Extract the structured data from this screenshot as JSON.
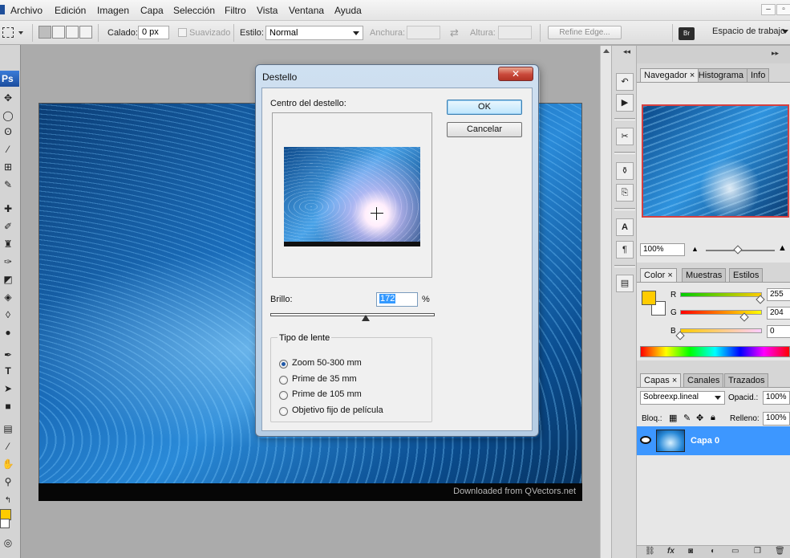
{
  "menubar": {
    "items": [
      "Archivo",
      "Edición",
      "Imagen",
      "Capa",
      "Selección",
      "Filtro",
      "Vista",
      "Ventana",
      "Ayuda"
    ]
  },
  "options": {
    "feather_label": "Calado:",
    "feather_value": "0 px",
    "antialias_label": "Suavizado",
    "style_label": "Estilo:",
    "style_value": "Normal",
    "width_label": "Anchura:",
    "height_label": "Altura:",
    "refine_edge": "Refine Edge...",
    "workspace": "Espacio de trabajo"
  },
  "tools": {
    "badge": "Ps"
  },
  "canvas": {
    "watermark": "Downloaded from QVectors.net"
  },
  "dialog": {
    "title": "Destello",
    "close_glyph": "✕",
    "center_label": "Centro del destello:",
    "ok": "OK",
    "cancel": "Cancelar",
    "brightness_label": "Brillo:",
    "brightness_value": "172",
    "brightness_percent": 0.58,
    "percent_sign": "%",
    "lens_group_title": "Tipo de lente",
    "lens_options": [
      {
        "label": "Zoom 50-300 mm",
        "checked": true
      },
      {
        "label": "Prime de 35 mm",
        "checked": false
      },
      {
        "label": "Prime de 105 mm",
        "checked": false
      },
      {
        "label": "Objetivo fijo de película",
        "checked": false
      }
    ]
  },
  "navigator": {
    "tabs": [
      "Navegador",
      "Histograma",
      "Info"
    ],
    "zoom": "100%"
  },
  "color_panel": {
    "tabs": [
      "Color",
      "Muestras",
      "Estilos"
    ],
    "channels": [
      {
        "label": "R",
        "value": "255",
        "level": 1.0
      },
      {
        "label": "G",
        "value": "204",
        "level": 0.8
      },
      {
        "label": "B",
        "value": "0",
        "level": 0.0
      }
    ],
    "foreground": "#ffcc00",
    "background": "#ffffff"
  },
  "layers": {
    "tabs": [
      "Capas",
      "Canales",
      "Trazados"
    ],
    "blend_mode": "Sobreexp.lineal",
    "opacity_label": "Opacid.:",
    "opacity_value": "100%",
    "lock_label": "Bloq.:",
    "fill_label": "Relleno:",
    "fill_value": "100%",
    "layer_name": "Capa 0"
  }
}
